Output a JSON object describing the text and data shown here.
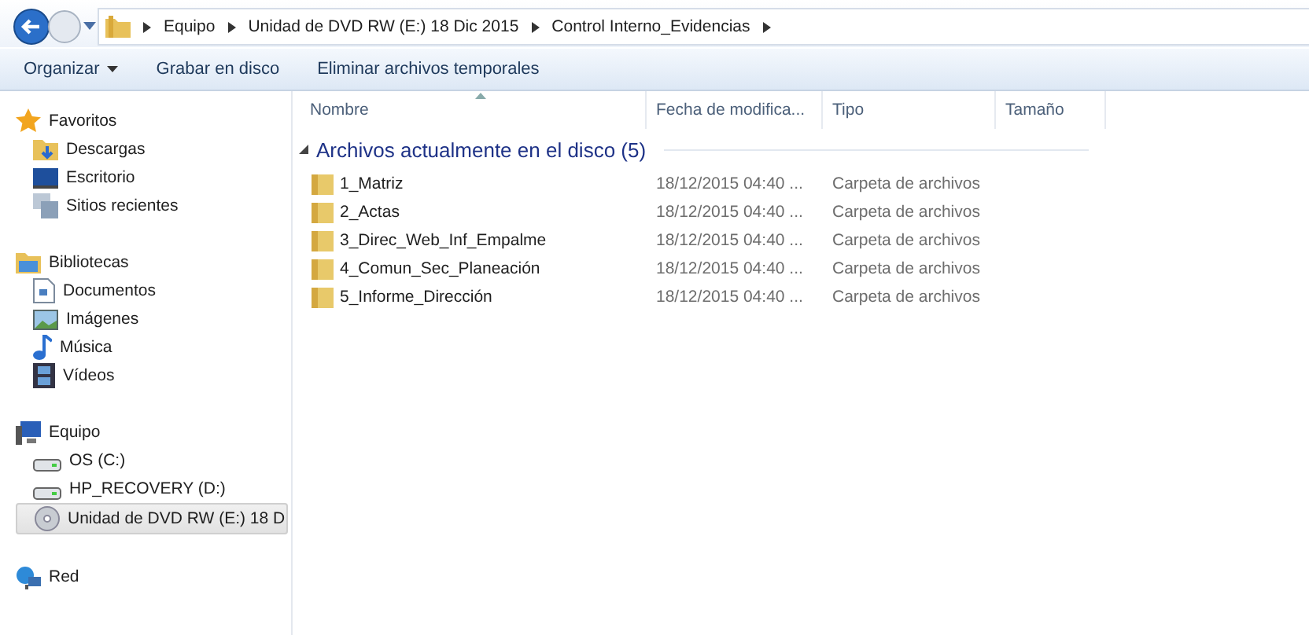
{
  "address_bar": {
    "breadcrumbs": [
      "Equipo",
      "Unidad de DVD RW (E:) 18 Dic 2015",
      "Control Interno_Evidencias"
    ]
  },
  "toolbar": {
    "buttons": [
      {
        "label": "Organizar",
        "has_menu": true
      },
      {
        "label": "Grabar en disco",
        "has_menu": false
      },
      {
        "label": "Eliminar archivos temporales",
        "has_menu": false
      }
    ]
  },
  "sidebar": {
    "groups": [
      {
        "label": "Favoritos",
        "items": [
          {
            "label": "Descargas",
            "selected": false
          },
          {
            "label": "Escritorio",
            "selected": false
          },
          {
            "label": "Sitios recientes",
            "selected": false
          }
        ]
      },
      {
        "label": "Bibliotecas",
        "items": [
          {
            "label": "Documentos",
            "selected": false
          },
          {
            "label": "Imágenes",
            "selected": false
          },
          {
            "label": "Música",
            "selected": false
          },
          {
            "label": "Vídeos",
            "selected": false
          }
        ]
      },
      {
        "label": "Equipo",
        "items": [
          {
            "label": "OS (C:)",
            "selected": false
          },
          {
            "label": "HP_RECOVERY (D:)",
            "selected": false
          },
          {
            "label": "Unidad de DVD RW (E:) 18 D",
            "selected": true
          }
        ]
      },
      {
        "label": "Red"
      }
    ]
  },
  "file_list": {
    "columns": [
      "Nombre",
      "Fecha de modifica...",
      "Tipo",
      "Tamaño"
    ],
    "group": {
      "label": "Archivos actualmente en el disco (5)",
      "expanded": true
    },
    "rows": [
      {
        "name": "1_Matriz",
        "date": "18/12/2015 04:40 ...",
        "type": "Carpeta de archivos"
      },
      {
        "name": "2_Actas",
        "date": "18/12/2015 04:40 ...",
        "type": "Carpeta de archivos"
      },
      {
        "name": "3_Direc_Web_Inf_Empalme",
        "date": "18/12/2015 04:40 ...",
        "type": "Carpeta de archivos"
      },
      {
        "name": "4_Comun_Sec_Planeación",
        "date": "18/12/2015 04:40 ...",
        "type": "Carpeta de archivos"
      },
      {
        "name": "5_Informe_Dirección",
        "date": "18/12/2015 04:40 ...",
        "type": "Carpeta de archivos"
      }
    ]
  }
}
